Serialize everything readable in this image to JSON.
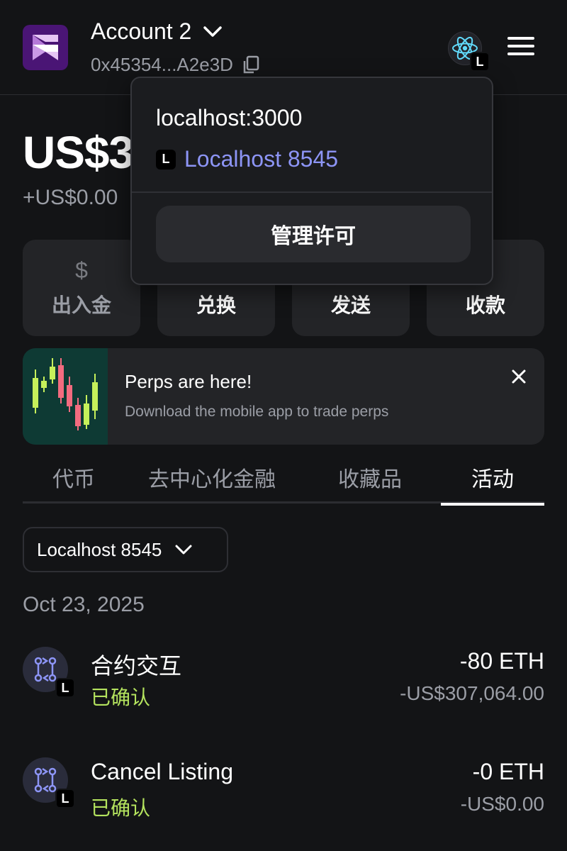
{
  "header": {
    "account_name": "Account 2",
    "account_address": "0x45354...A2e3D",
    "network_badge": "L"
  },
  "balance": {
    "amount": "US$3",
    "change": "+US$0.00"
  },
  "actions": [
    {
      "label": "出入金",
      "icon": "dollar-icon",
      "disabled": true
    },
    {
      "label": "兑换",
      "icon": "swap-icon",
      "disabled": false
    },
    {
      "label": "发送",
      "icon": "send-icon",
      "disabled": false
    },
    {
      "label": "收款",
      "icon": "receive-icon",
      "disabled": false
    }
  ],
  "banner": {
    "title": "Perps are here!",
    "subtitle": "Download the mobile app to trade perps"
  },
  "tabs": [
    {
      "label": "代币",
      "active": false
    },
    {
      "label": "去中心化金融",
      "active": false
    },
    {
      "label": "收藏品",
      "active": false
    },
    {
      "label": "活动",
      "active": true
    }
  ],
  "network_filter": {
    "label": "Localhost 8545"
  },
  "activity": {
    "date": "Oct 23, 2025",
    "items": [
      {
        "title": "合约交互",
        "status": "已确认",
        "amount": "-80 ETH",
        "fiat": "-US$307,064.00",
        "badge": "L"
      },
      {
        "title": "Cancel Listing",
        "status": "已确认",
        "amount": "-0 ETH",
        "fiat": "-US$0.00",
        "badge": "L"
      }
    ]
  },
  "popover": {
    "origin": "localhost:3000",
    "network_badge": "L",
    "network_name": "Localhost 8545",
    "manage_button": "管理许可"
  },
  "colors": {
    "background": "#131416",
    "card": "#232427",
    "accent_link": "#8d95f6",
    "confirmed": "#b4e35e",
    "muted": "#9b9ea6"
  }
}
